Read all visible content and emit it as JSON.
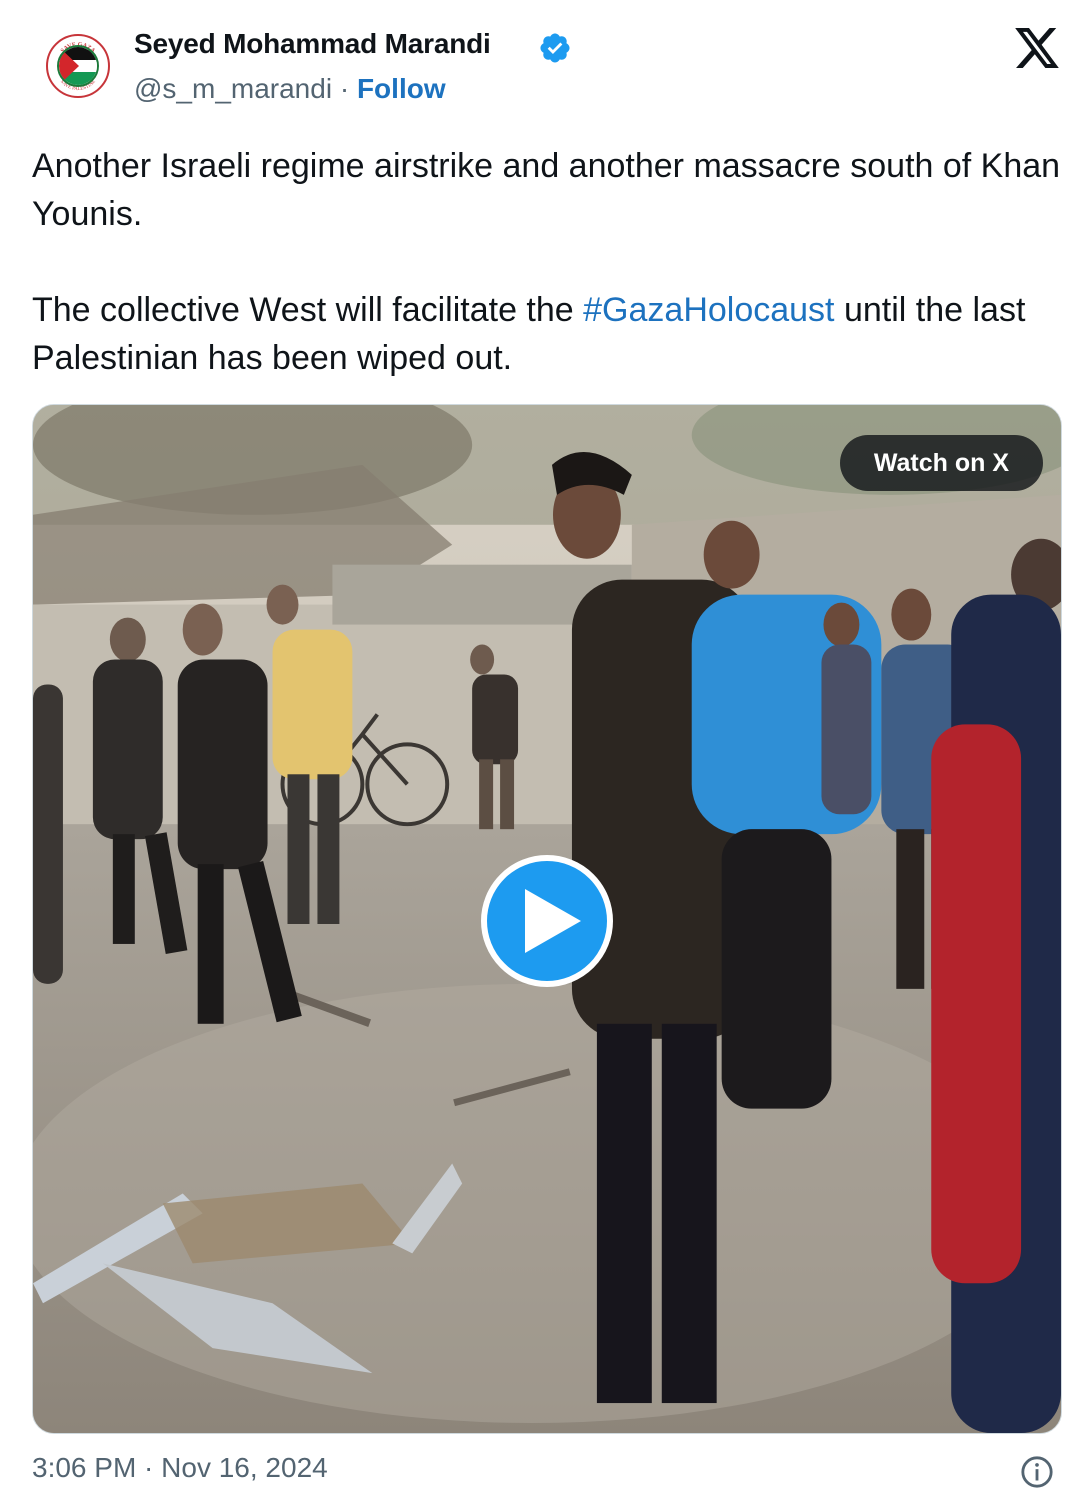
{
  "author": {
    "name": "Seyed Mohammad Marandi",
    "handle": "@s_m_marandi",
    "separator": " · ",
    "follow_label": "Follow",
    "avatar_top_text": "SAVE GAZA",
    "avatar_bottom_text": "SAVE PALESTINE"
  },
  "tweet": {
    "line1": "Another Israeli regime airstrike and another massacre south of Khan Younis.",
    "line2_before": "The collective West will facilitate the ",
    "hashtag": "#GazaHolocaust",
    "line2_after": " until the last Palestinian has been wiped out."
  },
  "media": {
    "watch_label": "Watch on X"
  },
  "footer": {
    "timestamp": "3:06 PM · Nov 16, 2024"
  },
  "icons": {
    "verified": "verified-badge-icon",
    "x_logo": "x-logo-icon",
    "play": "play-icon",
    "info": "info-icon"
  },
  "colors": {
    "link": "#1d72bf",
    "verified": "#1d9bf0",
    "secondary_text": "#536471",
    "play_button": "#1d9bf0"
  }
}
